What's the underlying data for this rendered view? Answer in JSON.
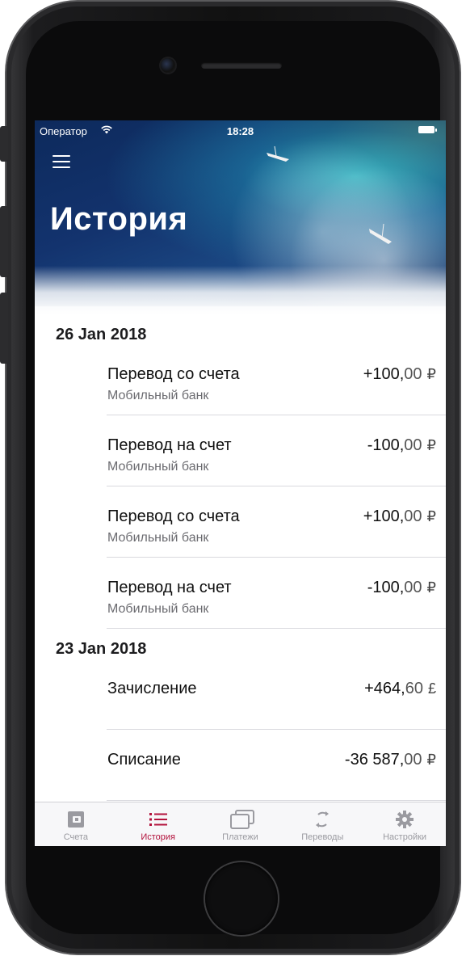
{
  "status_bar": {
    "carrier": "Оператор",
    "time": "18:28"
  },
  "header": {
    "title": "История",
    "menu_icon": "hamburger-menu-icon"
  },
  "colors": {
    "accent": "#b3123c",
    "tab_inactive": "#9a9aa0",
    "divider": "#d9d9de"
  },
  "history": [
    {
      "date": "26 Jan 2018",
      "items": [
        {
          "title": "Перевод со счета",
          "subtitle": "Мобильный банк",
          "amount_main": "+100,",
          "amount_cents": "00",
          "currency": "₽"
        },
        {
          "title": "Перевод на счет",
          "subtitle": "Мобильный банк",
          "amount_main": "-100,",
          "amount_cents": "00",
          "currency": "₽"
        },
        {
          "title": "Перевод со счета",
          "subtitle": "Мобильный банк",
          "amount_main": "+100,",
          "amount_cents": "00",
          "currency": "₽"
        },
        {
          "title": "Перевод на счет",
          "subtitle": "Мобильный банк",
          "amount_main": "-100,",
          "amount_cents": "00",
          "currency": "₽"
        }
      ]
    },
    {
      "date": "23 Jan 2018",
      "items": [
        {
          "title": "Зачисление",
          "subtitle": "",
          "amount_main": "+464,",
          "amount_cents": "60",
          "currency": "£"
        },
        {
          "title": "Списание",
          "subtitle": "",
          "amount_main": "-36 587,",
          "amount_cents": "00",
          "currency": "₽"
        }
      ]
    }
  ],
  "tabbar": [
    {
      "label": "Счета",
      "icon": "wallet-icon",
      "active": false
    },
    {
      "label": "История",
      "icon": "list-icon",
      "active": true
    },
    {
      "label": "Платежи",
      "icon": "cards-icon",
      "active": false
    },
    {
      "label": "Переводы",
      "icon": "refresh-arrows-icon",
      "active": false
    },
    {
      "label": "Настройки",
      "icon": "gear-icon",
      "active": false
    }
  ]
}
